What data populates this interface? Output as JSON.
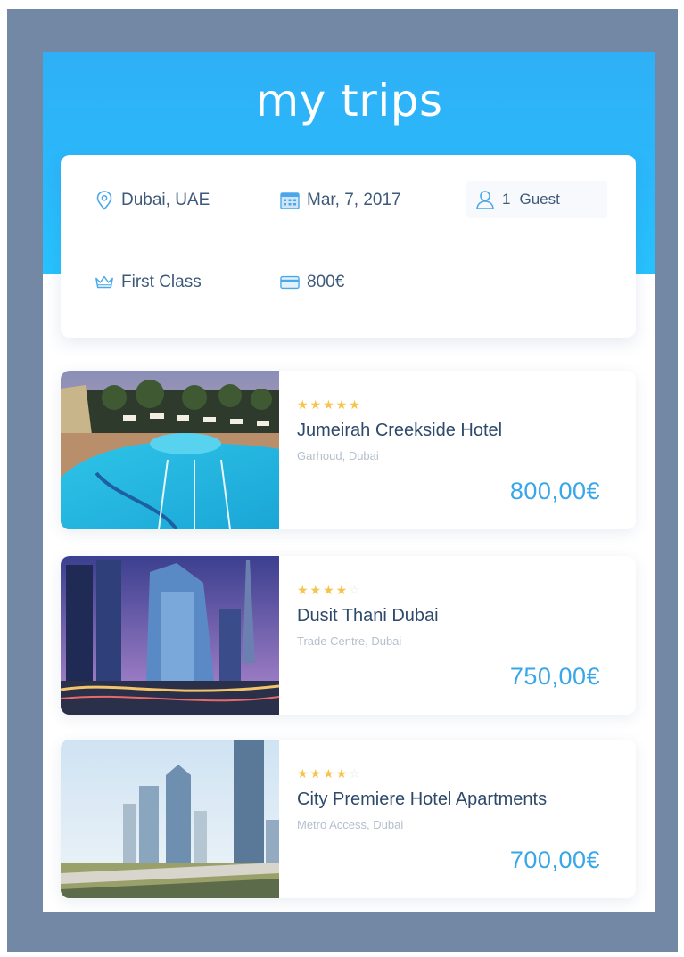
{
  "app": {
    "title": "my trips"
  },
  "search": {
    "location": "Dubai, UAE",
    "date": "Mar, 7, 2017",
    "guests_count": "1",
    "guests_label": "Guest",
    "travel_class": "First Class",
    "budget": "800€"
  },
  "hotels": [
    {
      "name": "Jumeirah Creekside Hotel",
      "area": "Garhoud, Dubai",
      "price": "800,00€",
      "stars_on": "★★★★★",
      "stars_off": ""
    },
    {
      "name": "Dusit Thani Dubai",
      "area": "Trade Centre, Dubai",
      "price": "750,00€",
      "stars_on": "★★★★",
      "stars_off": "☆"
    },
    {
      "name": "City Premiere Hotel Apartments",
      "area": "Metro Access, Dubai",
      "price": "700,00€",
      "stars_on": "★★★★",
      "stars_off": "☆"
    }
  ],
  "colors": {
    "header_gradient_top": "#2fb0f6",
    "header_gradient_bottom": "#27c2fd",
    "price": "#3aa6ea",
    "star": "#f6c44a",
    "text": "#2e4a6b",
    "backdrop": "#7388a5"
  },
  "icons": {
    "location": "map-pin-icon",
    "date": "calendar-icon",
    "guests": "user-icon",
    "class": "crown-icon",
    "budget": "credit-card-icon"
  }
}
